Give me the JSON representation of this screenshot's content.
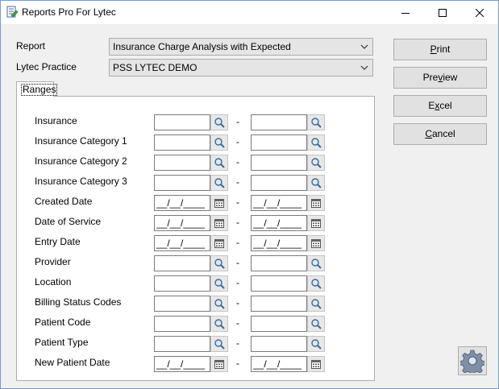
{
  "window": {
    "title": "Reports Pro For Lytec"
  },
  "form": {
    "report_label": "Report",
    "report_value": "Insurance Charge Analysis with Expected",
    "practice_label": "Lytec Practice",
    "practice_value": "PSS LYTEC DEMO"
  },
  "tabs": {
    "ranges_label": "Ranges"
  },
  "ranges": {
    "separator": "-",
    "rows": [
      {
        "label": "Insurance",
        "type": "lookup",
        "from": "",
        "to": ""
      },
      {
        "label": "Insurance Category 1",
        "type": "lookup",
        "from": "",
        "to": ""
      },
      {
        "label": "Insurance Category 2",
        "type": "lookup",
        "from": "",
        "to": ""
      },
      {
        "label": "Insurance Category 3",
        "type": "lookup",
        "from": "",
        "to": ""
      },
      {
        "label": "Created Date",
        "type": "date",
        "from": "__/__/____",
        "to": "__/__/____"
      },
      {
        "label": "Date of Service",
        "type": "date",
        "from": "__/__/____",
        "to": "__/__/____"
      },
      {
        "label": "Entry Date",
        "type": "date",
        "from": "__/__/____",
        "to": "__/__/____"
      },
      {
        "label": "Provider",
        "type": "lookup",
        "from": "",
        "to": ""
      },
      {
        "label": "Location",
        "type": "lookup",
        "from": "",
        "to": ""
      },
      {
        "label": "Billing Status Codes",
        "type": "lookup",
        "from": "",
        "to": ""
      },
      {
        "label": "Patient Code",
        "type": "lookup",
        "from": "",
        "to": ""
      },
      {
        "label": "Patient Type",
        "type": "lookup",
        "from": "",
        "to": ""
      },
      {
        "label": "New Patient Date",
        "type": "date",
        "from": "__/__/____",
        "to": "__/__/____"
      }
    ]
  },
  "actions": {
    "print_pre": "",
    "print_u": "P",
    "print_post": "rint",
    "preview_pre": "Pre",
    "preview_u": "v",
    "preview_post": "iew",
    "excel_pre": "E",
    "excel_u": "x",
    "excel_post": "cel",
    "cancel_pre": "",
    "cancel_u": "C",
    "cancel_post": "ancel"
  },
  "icons": {
    "app": "report-edit-icon",
    "lookup": "magnifier-icon",
    "date": "calendar-icon",
    "settings": "gear-icon"
  },
  "colors": {
    "window_bg": "#f0f0f0",
    "border": "#adadad",
    "field_border": "#7a7a7a"
  }
}
